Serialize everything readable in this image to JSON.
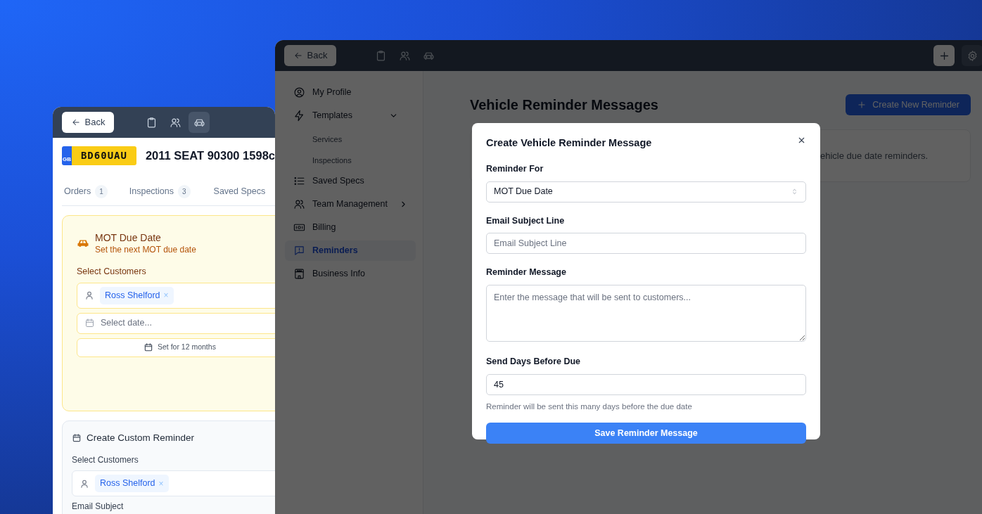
{
  "back_window": {
    "header": {
      "back_label": "Back",
      "nav_icons": [
        {
          "kind": "clipboard",
          "selected": false
        },
        {
          "kind": "users",
          "selected": false
        },
        {
          "kind": "car",
          "selected": true
        }
      ]
    },
    "plate": {
      "country": "GB",
      "number": "BD60UAU"
    },
    "vehicle_title": "2011 SEAT 90300 1598c",
    "tabs": [
      {
        "label": "Orders",
        "count": "1",
        "selected": false
      },
      {
        "label": "Inspections",
        "count": "3",
        "selected": false
      },
      {
        "label": "Saved Specs",
        "selected": false
      }
    ],
    "mot_card": {
      "title": "MOT Due Date",
      "subtitle": "Set the next MOT due date",
      "customers_label": "Select Customers",
      "customers": [
        {
          "name": "Ross Shelford",
          "remove": "×"
        }
      ],
      "date_placeholder": "Select date...",
      "set_button": "Set for 12 months"
    },
    "custom_card": {
      "title": "Create Custom Reminder",
      "customers_label": "Select Customers",
      "customers": [
        {
          "name": "Ross Shelford",
          "remove": "×"
        }
      ],
      "subject_label": "Email Subject"
    }
  },
  "front_window": {
    "header": {
      "back_label": "Back",
      "nav_icons": [
        {
          "kind": "clipboard"
        },
        {
          "kind": "users"
        },
        {
          "kind": "car"
        }
      ]
    },
    "sidebar": {
      "items": [
        {
          "label": "My Profile",
          "kind": "profile",
          "selected": false
        },
        {
          "label": "Templates",
          "kind": "bolt",
          "selected": false,
          "expanded": true,
          "children": [
            {
              "label": "Services",
              "selected": false
            },
            {
              "label": "Inspections",
              "selected": false
            }
          ]
        },
        {
          "label": "Saved Specs",
          "kind": "list",
          "selected": false
        },
        {
          "label": "Team Management",
          "kind": "users",
          "selected": false,
          "expanded": false
        },
        {
          "label": "Billing",
          "kind": "cash",
          "selected": false
        },
        {
          "label": "Reminders",
          "kind": "alert",
          "selected": true
        },
        {
          "label": "Business Info",
          "kind": "store",
          "selected": false
        }
      ]
    },
    "page_title": "Vehicle Reminder Messages",
    "create_button": "Create New Reminder",
    "card_text": "ehicle due date reminders.",
    "modal": {
      "title": "Create Vehicle Reminder Message",
      "reminder_for": {
        "label": "Reminder For",
        "value": "MOT Due Date"
      },
      "subject": {
        "label": "Email Subject Line",
        "placeholder": "Email Subject Line"
      },
      "message": {
        "label": "Reminder Message",
        "placeholder": "Enter the message that will be sent to customers..."
      },
      "days": {
        "label": "Send Days Before Due",
        "value": "45",
        "help": "Reminder will be sent this many days before the due date"
      },
      "save_button": "Save Reminder Message"
    }
  }
}
